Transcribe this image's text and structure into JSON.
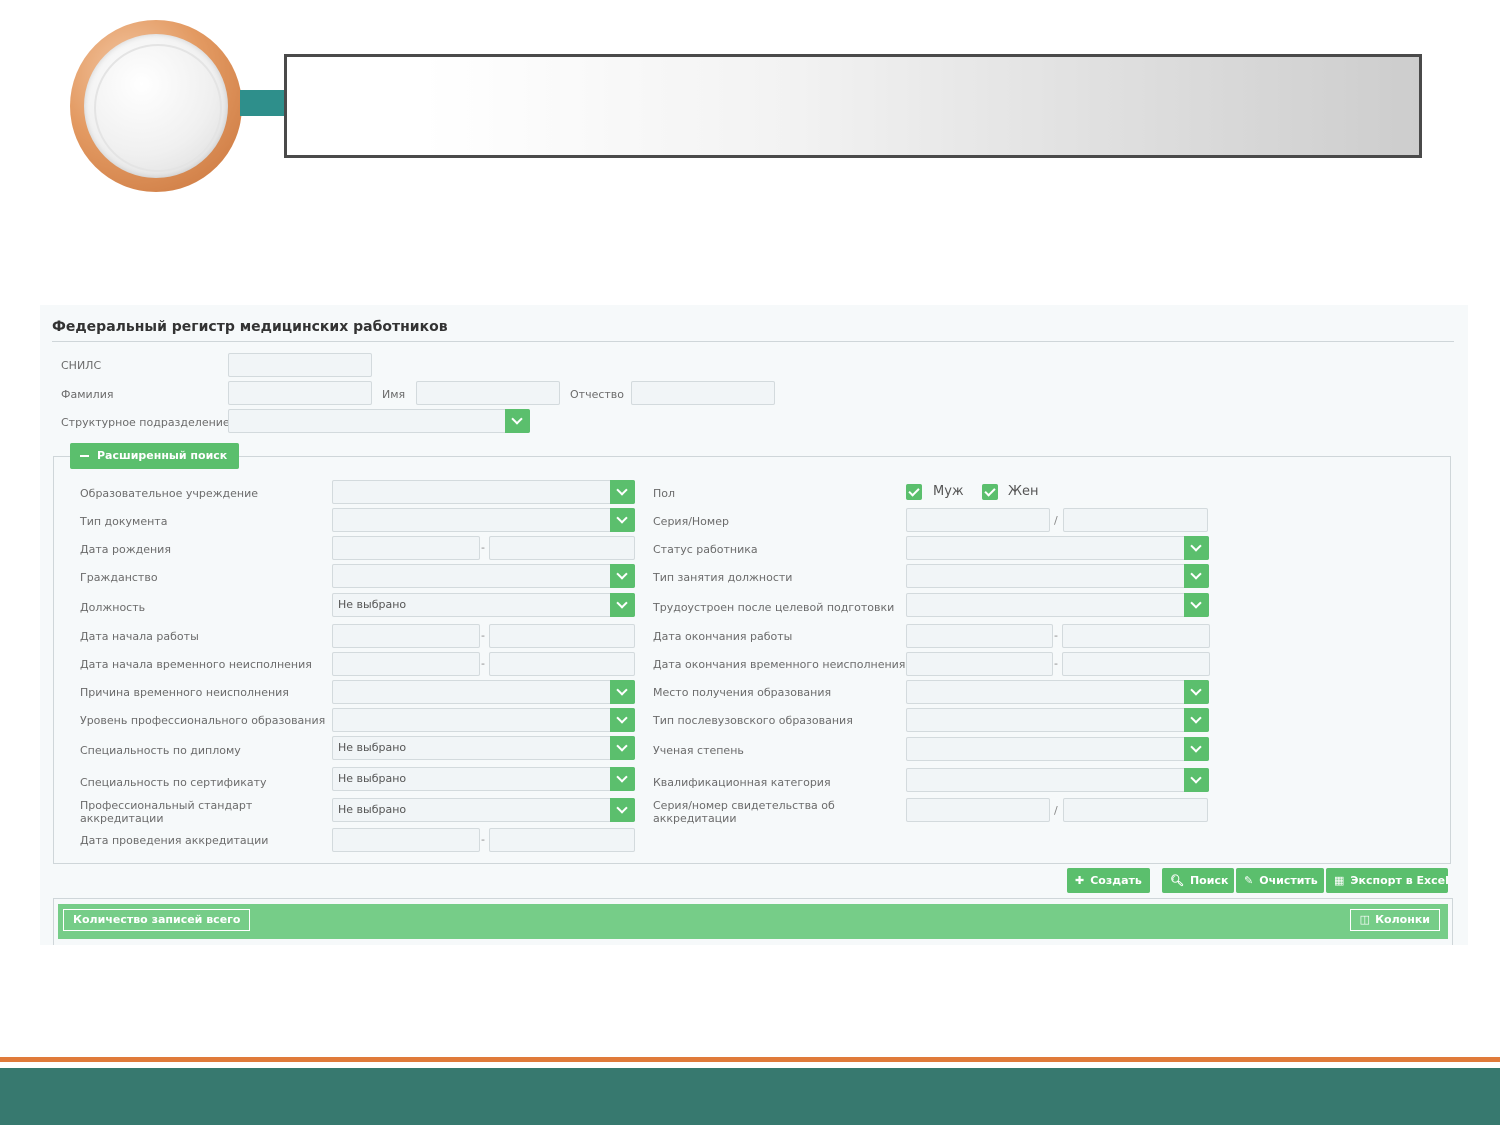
{
  "app": {
    "title": "Федеральный регистр медицинских работников"
  },
  "main_fields": {
    "snils": "СНИЛС",
    "last_name": "Фамилия",
    "first_name": "Имя",
    "middle_name": "Отчество",
    "division": "Структурное подразделение"
  },
  "advanced": {
    "toggle_label": "Расширенный поиск",
    "left": {
      "edu_institution": "Образовательное учреждение",
      "doc_type": "Тип документа",
      "birth_date": "Дата рождения",
      "citizenship": "Гражданство",
      "position": "Должность",
      "work_start": "Дата начала работы",
      "temp_start": "Дата начала временного неисполнения",
      "temp_reason": "Причина временного неисполнения",
      "edu_level": "Уровень профессионального образования",
      "diploma_spec": "Специальность по диплому",
      "cert_spec": "Специальность по сертификату",
      "prof_standard_1": "Профессиональный стандарт",
      "prof_standard_2": "аккредитации",
      "accr_date": "Дата проведения аккредитации"
    },
    "right": {
      "sex": "Пол",
      "male": "Муж",
      "female": "Жен",
      "series_number": "Серия/Номер",
      "worker_status": "Статус работника",
      "position_type": "Тип занятия должности",
      "employed_after": "Трудоустроен после целевой подготовки",
      "work_end": "Дата окончания работы",
      "temp_end": "Дата окончания временного неисполнения",
      "edu_place": "Место получения образования",
      "postgrad_type": "Тип послевузовского образования",
      "degree": "Ученая степень",
      "qual_category": "Квалификационная категория",
      "accr_cert_1": "Серия/номер свидетельства об",
      "accr_cert_2": "аккредитации"
    },
    "not_selected": "Не выбрано",
    "slash": "/",
    "dash": "-"
  },
  "actions": {
    "create": "Создать",
    "search": "Поиск",
    "clear": "Очистить",
    "export": "Экспорт в Excel"
  },
  "results": {
    "count_label": "Количество записей всего",
    "columns_label": "Колонки"
  },
  "colors": {
    "accent": "#5bbf6d",
    "teal": "#37796f",
    "orange": "#e07a3a"
  }
}
